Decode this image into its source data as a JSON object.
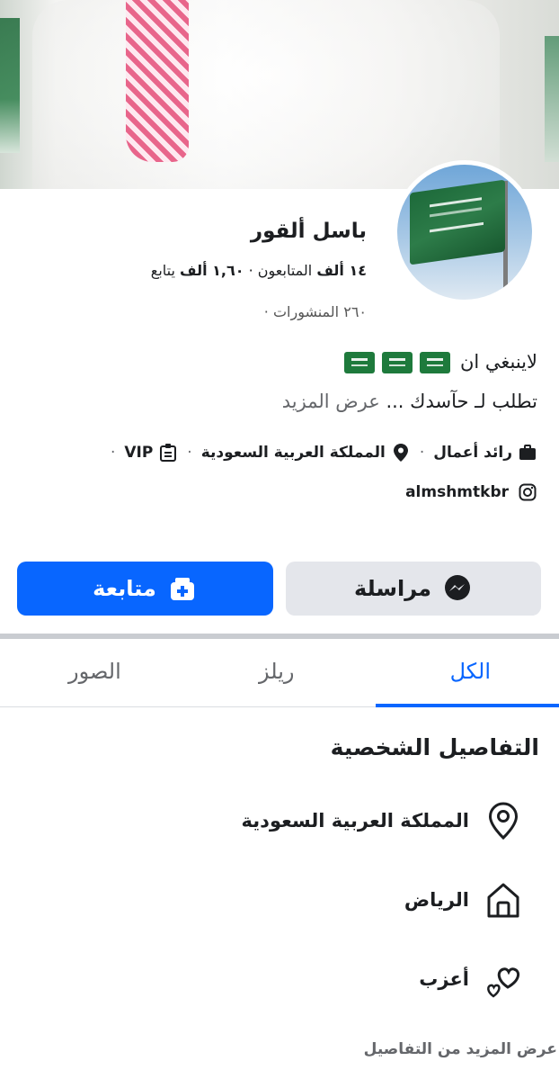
{
  "profile": {
    "name": "باسل ألقور",
    "followers_label": "المتابعون",
    "followers_count": "١٤ ألف",
    "following_label": "يتابع",
    "following_count": "١,٦٠ ألف",
    "posts_text": "٢٦٠ المنشورات",
    "bio_line1": "لاينبغي ان",
    "bio_line2": "تطلب لـ حآسدك ...",
    "bio_more": "عرض المزيد",
    "flag_emojis": [
      "saudi-flag",
      "saudi-flag",
      "saudi-flag"
    ]
  },
  "info": {
    "job": "رائد أعمال",
    "location": "المملكة العربية السعودية",
    "badge": "VIP",
    "instagram": "almshmtkbr"
  },
  "actions": {
    "follow_label": "متابعة",
    "message_label": "مراسلة"
  },
  "tabs": [
    {
      "label": "الكل",
      "active": true
    },
    {
      "label": "ريلز",
      "active": false
    },
    {
      "label": "الصور",
      "active": false
    }
  ],
  "details": {
    "title": "التفاصيل الشخصية",
    "items": [
      {
        "icon": "location-pin-icon",
        "text": "المملكة العربية السعودية"
      },
      {
        "icon": "home-icon",
        "text": "الرياض"
      },
      {
        "icon": "hearts-icon",
        "text": "أعزب"
      }
    ],
    "see_more": "عرض المزيد من التفاصيل"
  },
  "colors": {
    "accent": "#0866ff",
    "button_gray": "#e4e6eb",
    "text": "#1c1e21",
    "secondary": "#65676b"
  }
}
